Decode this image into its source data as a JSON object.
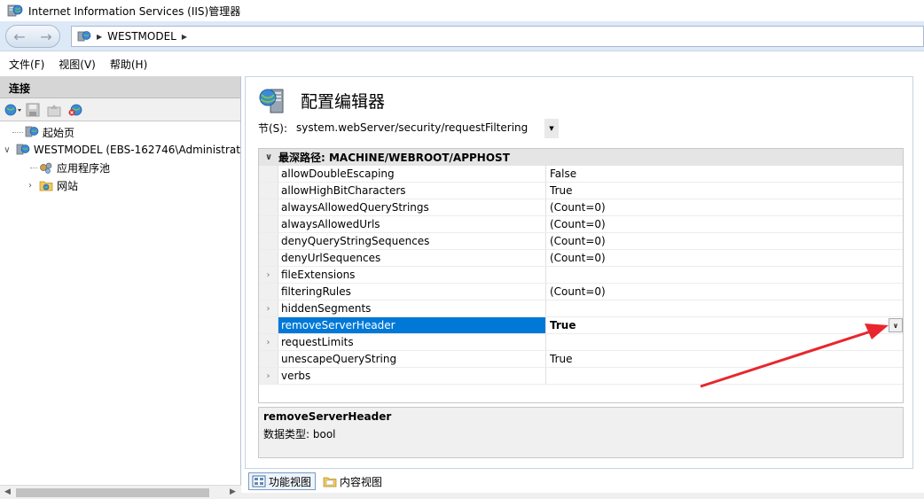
{
  "window": {
    "title": "Internet Information Services (IIS)管理器"
  },
  "address": {
    "crumbs": [
      "WESTMODEL"
    ]
  },
  "menu": {
    "items": [
      "文件(F)",
      "视图(V)",
      "帮助(H)"
    ]
  },
  "connections": {
    "title": "连接",
    "tree": [
      {
        "label": "起始页",
        "icon": "start-page-icon"
      },
      {
        "label": "WESTMODEL (EBS-162746\\Administrat",
        "icon": "server-icon",
        "expanded": true
      },
      {
        "label": "应用程序池",
        "icon": "app-pool-icon"
      },
      {
        "label": "网站",
        "icon": "sites-folder-icon",
        "expanded": false
      }
    ]
  },
  "page": {
    "title": "配置编辑器",
    "section_label": "节(S):",
    "section_value": "system.webServer/security/requestFiltering"
  },
  "grid": {
    "header": "最深路径: MACHINE/WEBROOT/APPHOST",
    "rows": [
      {
        "name": "allowDoubleEscaping",
        "value": "False",
        "expandable": false
      },
      {
        "name": "allowHighBitCharacters",
        "value": "True",
        "expandable": false
      },
      {
        "name": "alwaysAllowedQueryStrings",
        "value": "(Count=0)",
        "expandable": false
      },
      {
        "name": "alwaysAllowedUrls",
        "value": "(Count=0)",
        "expandable": false
      },
      {
        "name": "denyQueryStringSequences",
        "value": "(Count=0)",
        "expandable": false
      },
      {
        "name": "denyUrlSequences",
        "value": "(Count=0)",
        "expandable": false
      },
      {
        "name": "fileExtensions",
        "value": "",
        "expandable": true
      },
      {
        "name": "filteringRules",
        "value": "(Count=0)",
        "expandable": false
      },
      {
        "name": "hiddenSegments",
        "value": "",
        "expandable": true
      },
      {
        "name": "removeServerHeader",
        "value": "True",
        "expandable": false,
        "selected": true
      },
      {
        "name": "requestLimits",
        "value": "",
        "expandable": true
      },
      {
        "name": "unescapeQueryString",
        "value": "True",
        "expandable": false
      },
      {
        "name": "verbs",
        "value": "",
        "expandable": true
      }
    ]
  },
  "description": {
    "name": "removeServerHeader",
    "type": "数据类型: bool"
  },
  "view_tabs": [
    {
      "label": "功能视图",
      "active": true
    },
    {
      "label": "内容视图",
      "active": false
    }
  ],
  "colors": {
    "selection": "#0078d7",
    "annotation_arrow": "#e8262d"
  }
}
